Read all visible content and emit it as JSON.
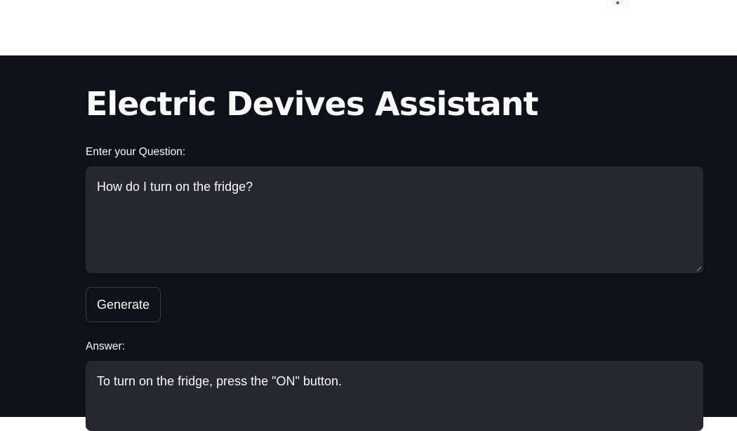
{
  "app": {
    "title": "Electric Devives Assistant"
  },
  "question": {
    "label": "Enter your Question:",
    "value": "How do I turn on the fridge?"
  },
  "actions": {
    "generate_label": "Generate"
  },
  "answer": {
    "label": "Answer:",
    "value": "To turn on the fridge, press the \"ON\" button."
  },
  "colors": {
    "background": "#0e1117",
    "header_background": "#ffffff",
    "input_background": "#262730",
    "text": "#fafafa",
    "status_dot": "#e0282e"
  }
}
